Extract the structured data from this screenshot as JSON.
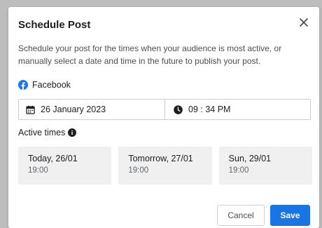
{
  "dialog": {
    "title": "Schedule Post",
    "description": "Schedule your post for the times when your audience is most active, or manually select a date and time in the future to publish your post.",
    "platform_icon": "facebook-icon",
    "platform": "Facebook",
    "date_value": "26 January 2023",
    "time_value": "09 : 34 PM",
    "active_times_label": "Active times",
    "slots": [
      {
        "day": "Today, 26/01",
        "time": "19:00"
      },
      {
        "day": "Tomorrow, 27/01",
        "time": "19:00"
      },
      {
        "day": "Sun, 29/01",
        "time": "19:00"
      }
    ],
    "cancel_label": "Cancel",
    "save_label": "Save"
  },
  "colors": {
    "accent": "#1b74e4",
    "facebook": "#1877f2",
    "slot_background": "#f0f0f0",
    "backdrop": "#bdbdbd"
  }
}
